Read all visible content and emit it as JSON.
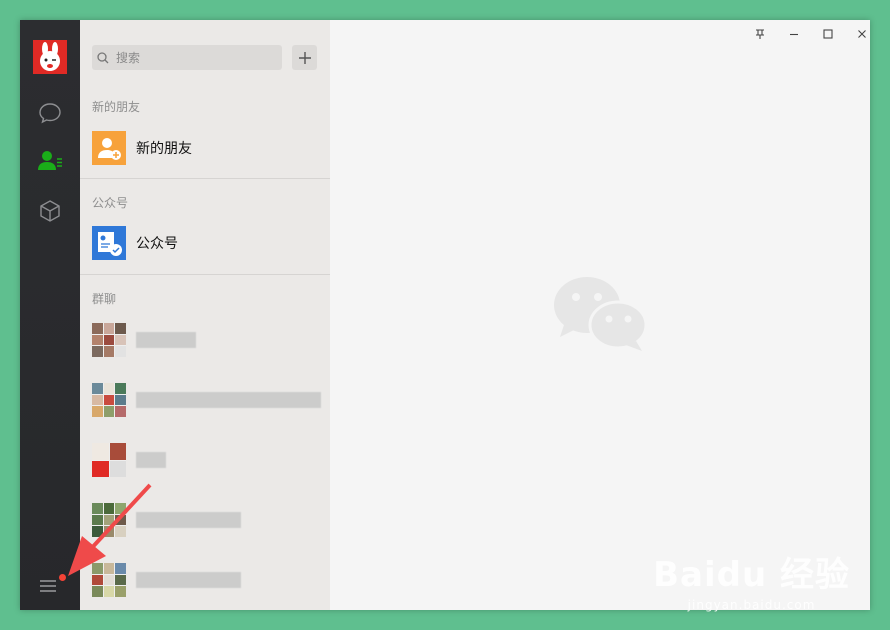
{
  "search": {
    "placeholder": "搜索"
  },
  "sections": [
    {
      "label": "新的朋友",
      "item": "新的朋友"
    },
    {
      "label": "公众号",
      "item": "公众号"
    },
    {
      "label": "群聊"
    }
  ],
  "groups": [
    {
      "name_blurred": true
    },
    {
      "name_blurred": true
    },
    {
      "name_blurred": true
    },
    {
      "name_blurred": true
    },
    {
      "name_blurred": true
    }
  ],
  "colors": {
    "accent_green": "#1aad19",
    "new_friends_orange": "#f7a23b",
    "official_blue": "#2f78d8",
    "notification_red": "#f44336"
  },
  "watermark": {
    "brand": "Baidu 经验",
    "url": "jingyan.baidu.com"
  }
}
